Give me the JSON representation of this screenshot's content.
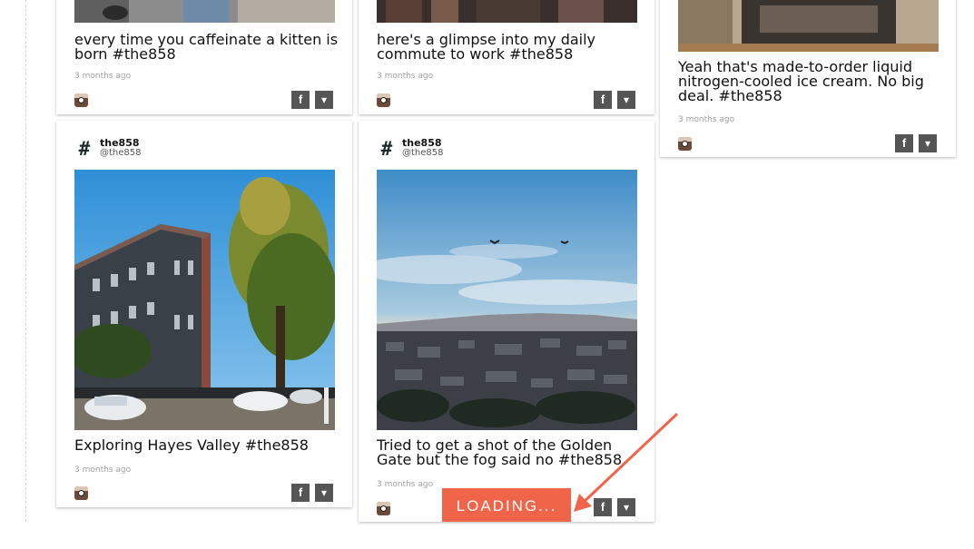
{
  "feed": {
    "cards": [
      {
        "caption": "every time you caffeinate a kitten is born #the858",
        "time": "3 months ago"
      },
      {
        "caption": "here's a glimpse into my daily commute to work #the858",
        "time": "3 months ago"
      },
      {
        "caption": "Yeah that's made-to-order liquid nitrogen-cooled ice cream. No big deal. #the858",
        "time": "3 months ago"
      },
      {
        "author_name": "the858",
        "author_handle": "@the858",
        "caption": "Exploring Hayes Valley #the858",
        "time": "3 months ago"
      },
      {
        "author_name": "the858",
        "author_handle": "@the858",
        "caption": "Tried to get a shot of the Golden Gate but the fog said no #the858",
        "time": "3 months ago"
      }
    ]
  },
  "share": {
    "facebook_label": "f",
    "twitter_label": "🐦"
  },
  "loading": {
    "label": "LOADING..."
  },
  "icons": {
    "source": "instagram-icon",
    "facebook": "facebook-icon",
    "twitter": "twitter-icon",
    "avatar": "hashtag-icon"
  },
  "colors": {
    "loading_bg": "#f0644a",
    "arrow": "#f0644a",
    "share_bg": "#555555"
  }
}
